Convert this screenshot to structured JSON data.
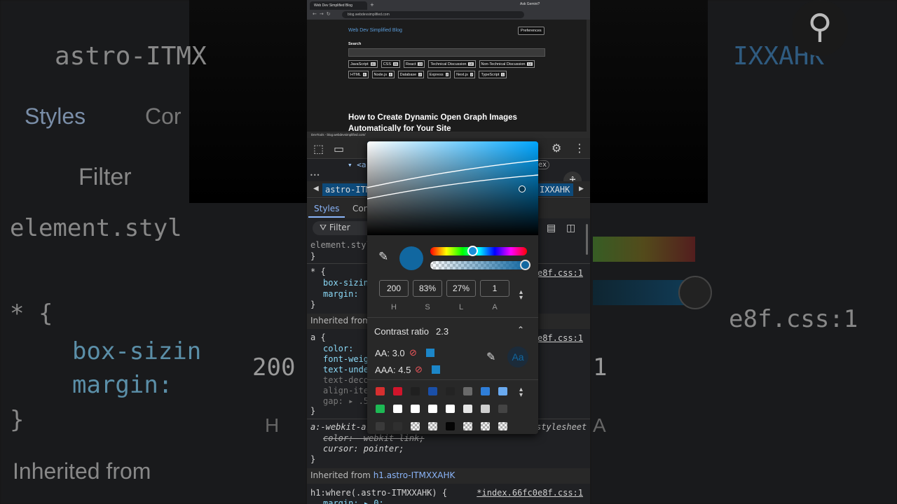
{
  "browser": {
    "tab_title": "Web Dev Simplified Blog",
    "new_tab": "+",
    "ask_gemini": "Ask Gemini?",
    "url": "blog.webdevsimplified.com"
  },
  "blog": {
    "site_title": "Web Dev Simplified Blog",
    "preferences": "Preferences",
    "search_label": "Search",
    "tags": [
      {
        "name": "JavaScript",
        "count": "34"
      },
      {
        "name": "CSS",
        "count": "36"
      },
      {
        "name": "React",
        "count": "22"
      },
      {
        "name": "Technical Discussion",
        "count": "18"
      },
      {
        "name": "Non-Technical Discussion",
        "count": "12"
      },
      {
        "name": "HTML",
        "count": "6"
      },
      {
        "name": "Node.js",
        "count": "4"
      },
      {
        "name": "Database",
        "count": "2"
      },
      {
        "name": "Express",
        "count": "2"
      },
      {
        "name": "Next.js",
        "count": "2"
      },
      {
        "name": "TypeScript",
        "count": "1"
      }
    ],
    "post_title": "How to Create Dynamic Open Graph Images Automatically for Your Site"
  },
  "devtools": {
    "title": "DevTools - blog.webdevsimplified.com/",
    "element_line": "▾ <a",
    "ex_badge": "ex",
    "dots": "•••",
    "crumb_left": "astro-ITMX",
    "crumb_right": "IXXAHK",
    "tab_styles": "Styles",
    "tab_computed": "Con",
    "filter_placeholder": "Filter",
    "rules": {
      "element_style": "element.style",
      "close1": "}",
      "star_open": "* {",
      "box_sizing": "box-sizin",
      "margin": "margin:",
      "close2": "}",
      "star_link": "0e8f.css:1",
      "inherited1": "Inherited from",
      "a_open": "a {",
      "a_link": "0e8f.css:1",
      "color": "color:",
      "font_weight": "font-weig",
      "text_decoration": "text-unde",
      "text_deco": "text-deco",
      "align_items": "align-ite",
      "gap": "gap: ▸ .5",
      "close3": "}",
      "webkit": "a:-webkit-ar",
      "ua_sheet": "stylesheet",
      "strike_color": "color: -webkit-link;",
      "cursor": "cursor: pointer;",
      "close4": "}",
      "inherited_from": "Inherited from",
      "inherited_el": "h1.astro-ITMXXAHK",
      "h1_rule": "h1:where(.astro-ITMXXAHK) {",
      "h1_link": "*index.66fc0e8f.css:1",
      "h1_margin": "margin: ▸ 0;"
    }
  },
  "picker": {
    "h": "200",
    "s": "83%",
    "l": "27%",
    "a": "1",
    "h_label": "H",
    "s_label": "S",
    "l_label": "L",
    "a_label": "A",
    "contrast_label": "Contrast ratio",
    "contrast_value": "2.3",
    "aa_label": "AA: 3.0",
    "aaa_label": "AAA: 4.5",
    "preview_text": "Aa",
    "current_color": "#1167a0"
  },
  "palette": [
    "#d62f2f",
    "#d0152b",
    "#202020",
    "#1a4fa8",
    "#232323",
    "#6a6a6a",
    "#2f7ed8",
    "#6aaaf0",
    "#1db954",
    "#ffffff",
    "#ffffff",
    "#ffffff",
    "#ffffff",
    "#e6e6e6",
    "#cfcfcf",
    "#444444",
    "#3a3a3a",
    "#2f2f2f",
    "checker",
    "checker",
    "#050505",
    "checker",
    "checker",
    "checker"
  ],
  "background": {
    "left_crumb": "astro-ITMX",
    "left_styles": "Styles",
    "left_computed": "Cor",
    "left_filter": "Filter",
    "left_element": "element.styl",
    "left_star": "* {",
    "left_box": "box-sizin",
    "left_margin": "margin:",
    "left_close": "}",
    "left_hval": "200",
    "left_h": "H",
    "left_inherited": "Inherited from",
    "right_crumb": "IXXAHK",
    "right_css": "e8f.css:1",
    "right_a": "1",
    "right_a_label": "A"
  }
}
